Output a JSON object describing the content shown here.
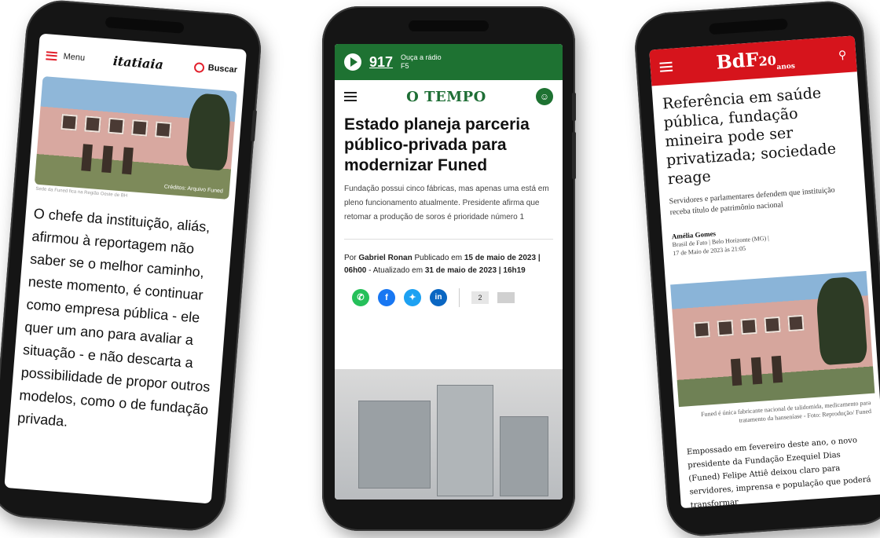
{
  "itatiaia": {
    "menu_label": "Menu",
    "logo": "itatiaia",
    "search_label": "Buscar",
    "photo_credit": "Créditos: Arquivo Funed",
    "photo_caption": "Sede da Funed fica na Região Oeste de BH",
    "body": "O chefe da instituição, aliás, afirmou à reportagem não saber se o melhor caminho, neste momento, é continuar como empresa pública - ele quer um ano para avaliar a situação - e não descarta a possibilidade de propor outros modelos, como o de fundação privada."
  },
  "otempo": {
    "radio_freq": "917",
    "radio_line1": "Ouça a rádio",
    "radio_line2": "F5",
    "logo": "O TEMPO",
    "headline": "Estado planeja parceria público-privada para modernizar Funed",
    "subhead": "Fundação possui cinco fábricas, mas apenas uma está em pleno funcionamento atualmente. Presidente afirma que retomar a produção de soros é prioridade número 1",
    "by_prefix": "Por",
    "author": "Gabriel Ronan",
    "published_prefix": "Publicado em",
    "published_date": "15 de maio de 2023",
    "published_time": "| 06h00",
    "updated_prefix": "- Atualizado em",
    "updated_date": "31 de maio de 2023 | 16h19",
    "comment_count": "2"
  },
  "bdf": {
    "logo": "BdF",
    "logo_badge": "20",
    "logo_badge_sub": "anos",
    "headline": "Referência em saúde pública, fundação mineira pode ser privatizada; sociedade reage",
    "subhead": "Servidores e parlamentares defendem que instituição receba título de patrimônio nacional",
    "author": "Amélia Gomes",
    "outlet": "Brasil de Fato | Belo Horizonte (MG) |",
    "date": "17 de Maio de 2023 às 21:05",
    "photo_caption": "Funed é única fabricante nacional de talidomida, medicamento para tratamento da hanseníase - Foto: Reprodução/ Funed",
    "body": "Empossado em fevereiro deste ano, o novo presidente da Fundação Ezequiel Dias (Funed) Felipe Attiê deixou claro para servidores, imprensa e população que poderá transformar"
  },
  "colors": {
    "otempo_green": "#1e7232",
    "bdf_red": "#d6141c",
    "itatiaia_red": "#e2202c"
  }
}
